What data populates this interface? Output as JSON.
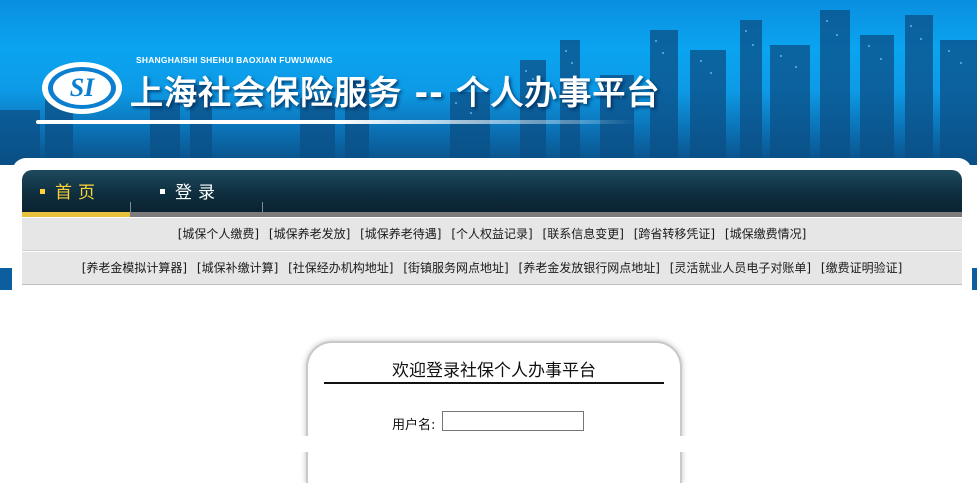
{
  "header": {
    "brand_pinyin": "SHANGHAISHI SHEHUI BAOXIAN FUWUWANG",
    "logo_text": "SI",
    "title": "上海社会保险服务 -- 个人办事平台"
  },
  "nav": {
    "home": "首页",
    "login": "登录"
  },
  "links_row1": [
    "[城保个人缴费]",
    "[城保养老发放]",
    "[城保养老待遇]",
    "[个人权益记录]",
    "[联系信息变更]",
    "[跨省转移凭证]",
    "[城保缴费情况]"
  ],
  "links_row2": [
    "[养老金模拟计算器]",
    "[城保补缴计算]",
    "[社保经办机构地址]",
    "[街镇服务网点地址]",
    "[养老金发放银行网点地址]",
    "[灵活就业人员电子对账单]",
    "[缴费证明验证]"
  ],
  "login": {
    "title": "欢迎登录社保个人办事平台",
    "username_label": "用户名:",
    "username_value": ""
  },
  "colors": {
    "nav_active": "#ffd23a",
    "nav_bg": "#0e2f3f",
    "banner_blue": "#0aa4f0"
  }
}
